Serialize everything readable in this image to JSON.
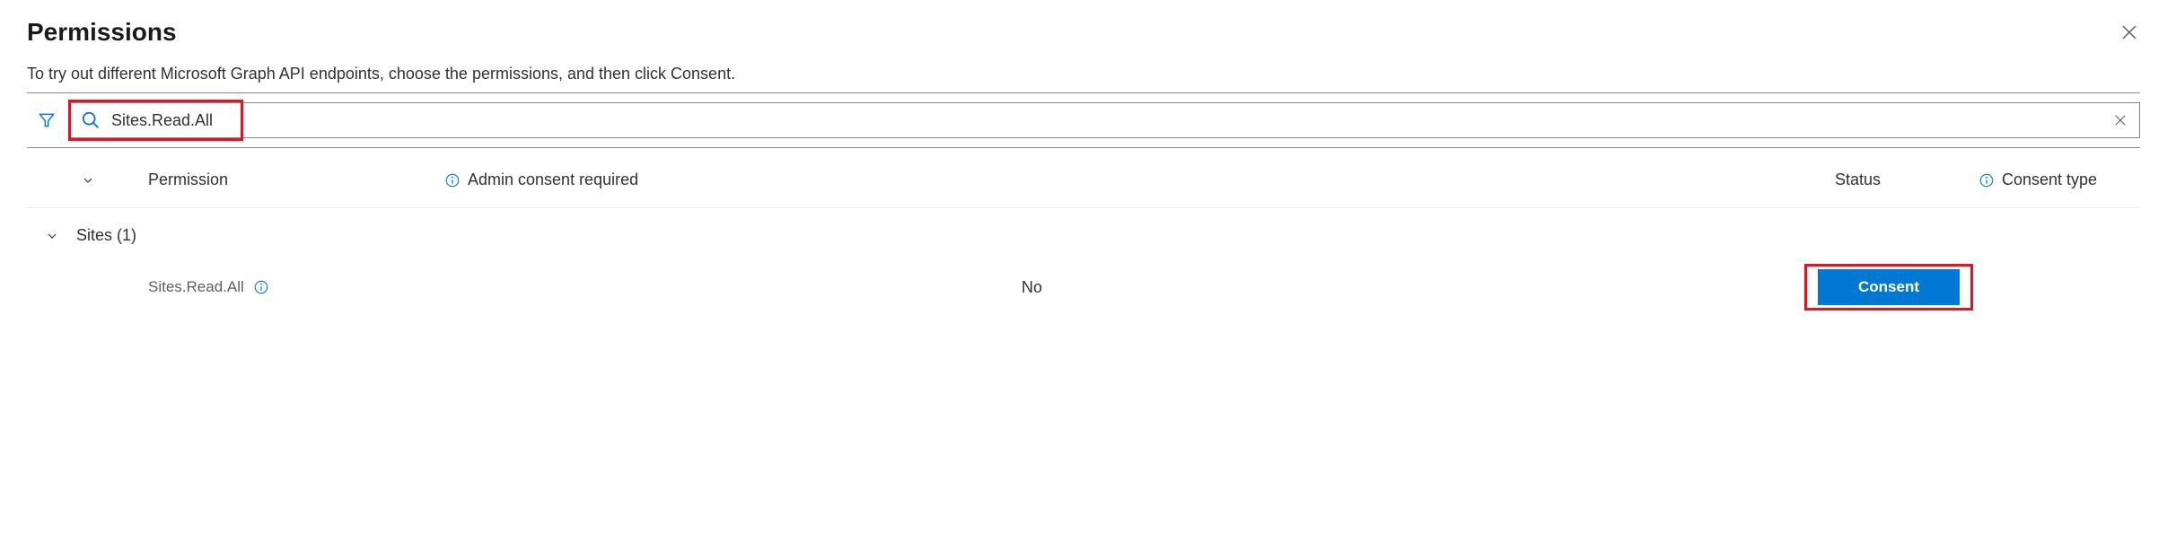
{
  "header": {
    "title": "Permissions"
  },
  "description": "To try out different Microsoft Graph API endpoints, choose the permissions, and then click Consent.",
  "search": {
    "value": "Sites.Read.All"
  },
  "columns": {
    "permission": "Permission",
    "admin_consent": "Admin consent required",
    "status": "Status",
    "consent_type": "Consent type"
  },
  "group": {
    "label": "Sites (1)"
  },
  "rows": [
    {
      "permission": "Sites.Read.All",
      "admin_consent": "No",
      "action_label": "Consent"
    }
  ]
}
